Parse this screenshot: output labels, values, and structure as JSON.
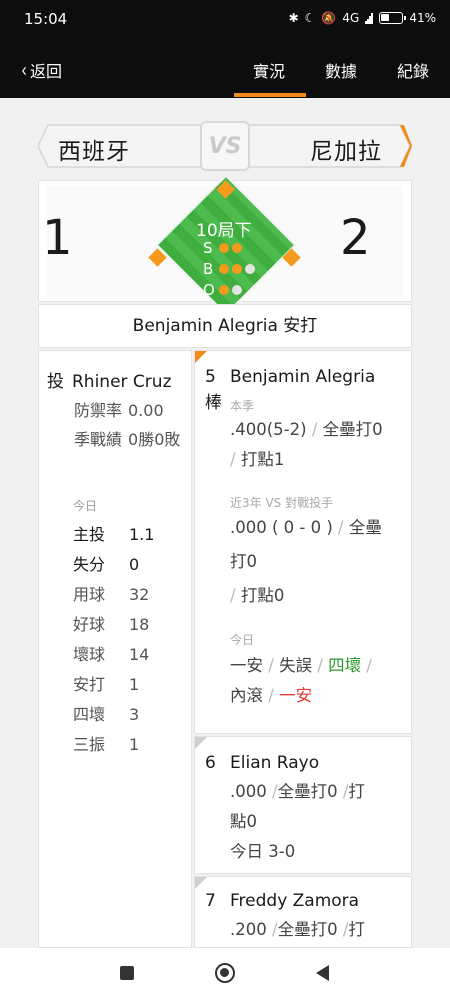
{
  "status": {
    "time": "15:04",
    "battery": "41",
    "network": "4G"
  },
  "nav": {
    "back": "返回",
    "tabs": [
      "實況",
      "數據",
      "紀錄"
    ],
    "active_tab": "實況"
  },
  "game": {
    "home_team": "西班牙",
    "away_team": "尼加拉",
    "vs": "VS",
    "home_score": "1",
    "away_score": "2",
    "inning": "10局下",
    "balls": 2,
    "strikes": 2,
    "outs": 1,
    "count_labels": {
      "s": "S",
      "b": "B",
      "o": "O"
    },
    "play": "Benjamin Alegria 安打"
  },
  "pitcher": {
    "role": "投",
    "name": "Rhiner Cruz",
    "era_label": "防禦率",
    "era": "0.00",
    "record_label": "季戰績",
    "record": "0勝0敗",
    "today_label": "今日",
    "stats": [
      {
        "k": "主投",
        "v": "1.1"
      },
      {
        "k": "失分",
        "v": "0"
      },
      {
        "k": "用球",
        "v": "32"
      },
      {
        "k": "好球",
        "v": "18"
      },
      {
        "k": "壞球",
        "v": "14"
      },
      {
        "k": "安打",
        "v": "1"
      },
      {
        "k": "四壞",
        "v": "3"
      },
      {
        "k": "三振",
        "v": "1"
      }
    ]
  },
  "batters": {
    "current": {
      "order": "5",
      "order_suffix": "棒",
      "name": "Benjamin Alegria",
      "season_label": "本季",
      "season_1": ".400(5-2)",
      "season_2": "全壘打0",
      "season_3": "打點1",
      "vs_label": "近3年 VS 對戰投手",
      "vs_1": ".000 ( 0 - 0 )",
      "vs_2": "全壘",
      "vs_3": "打0",
      "vs_4": "打點0",
      "today_label": "今日",
      "today": [
        "一安",
        "失誤",
        "四壞",
        "內滾",
        "一安"
      ]
    },
    "next": [
      {
        "order": "6",
        "name": "Elian Rayo",
        "line1": ".000",
        "line2": "全壘打0",
        "line3": "打",
        "line4": "點0",
        "today": "今日 3-0"
      },
      {
        "order": "7",
        "name": "Freddy Zamora",
        "line1": ".200",
        "line2": "全壘打0",
        "line3": "打"
      }
    ]
  }
}
